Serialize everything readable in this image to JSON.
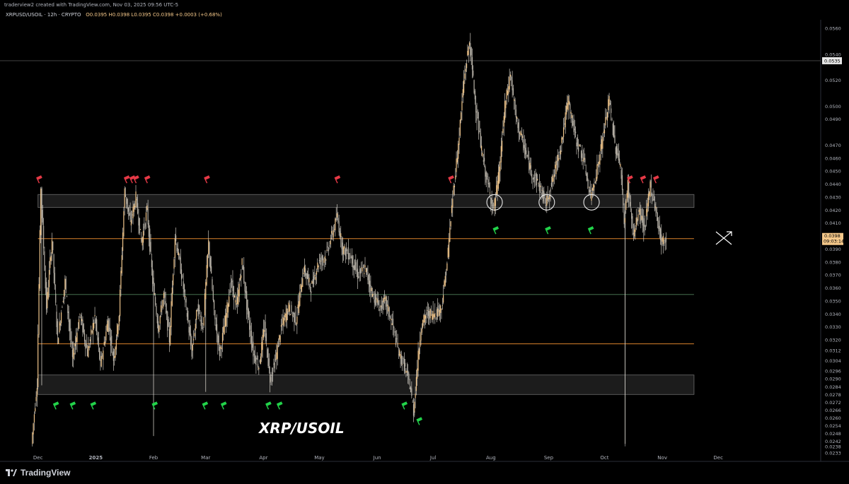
{
  "header": {
    "credit": "traderview2 created with TradingView.com, Nov 03, 2025 09:56 UTC-5",
    "symbol_line": "XRPUSD/USOIL · 12h · CRYPTO",
    "ohlc": "O0.0395  H0.0398  L0.0395  C0.0398  +0.0003 (+0.68%)"
  },
  "watermark": "XRP/USOIL",
  "brand": "TradingView",
  "colors": {
    "candle": "#f0c58a",
    "wick": "#e9e4da",
    "zone_fill": "#1c1c1c",
    "zone_border": "#6b6b6b",
    "orange_line": "#d9822b",
    "green_line": "#4f7f5a",
    "top_flag": "#e53946",
    "bottom_flag": "#22d34a",
    "price_tag": "#f5c88a"
  },
  "chart_data": {
    "type": "candlestick",
    "symbol": "XRPUSD/USOIL",
    "interval": "12h",
    "ylim": [
      0.0233,
      0.056
    ],
    "y_ticks": [
      "0.0560",
      "0.0540",
      "0.0520",
      "0.0500",
      "0.0490",
      "0.0470",
      "0.0460",
      "0.0450",
      "0.0440",
      "0.0430",
      "0.0420",
      "0.0410",
      "0.0400",
      "0.0390",
      "0.0380",
      "0.0370",
      "0.0360",
      "0.0350",
      "0.0340",
      "0.0330",
      "0.0320",
      "0.0312",
      "0.0304",
      "0.0296",
      "0.0290",
      "0.0284",
      "0.0278",
      "0.0272",
      "0.0266",
      "0.0260",
      "0.0254",
      "0.0248",
      "0.0242",
      "0.0238",
      "0.0233"
    ],
    "x_ticks": [
      "Dec",
      "2025",
      "Feb",
      "Mar",
      "Apr",
      "May",
      "Jun",
      "Jul",
      "Aug",
      "Sep",
      "Oct",
      "Nov",
      "Dec"
    ],
    "price_path": [
      [
        "2024-11-28",
        0.024
      ],
      [
        "2024-12-01",
        0.0287
      ],
      [
        "2024-12-03",
        0.0438
      ],
      [
        "2024-12-06",
        0.0345
      ],
      [
        "2024-12-09",
        0.0398
      ],
      [
        "2024-12-12",
        0.032
      ],
      [
        "2024-12-16",
        0.0365
      ],
      [
        "2024-12-20",
        0.0305
      ],
      [
        "2024-12-24",
        0.034
      ],
      [
        "2024-12-28",
        0.031
      ],
      [
        "2025-01-01",
        0.0338
      ],
      [
        "2025-01-04",
        0.03
      ],
      [
        "2025-01-08",
        0.0335
      ],
      [
        "2025-01-11",
        0.0305
      ],
      [
        "2025-01-14",
        0.034
      ],
      [
        "2025-01-17",
        0.0435
      ],
      [
        "2025-01-20",
        0.041
      ],
      [
        "2025-01-23",
        0.043
      ],
      [
        "2025-01-26",
        0.0395
      ],
      [
        "2025-01-29",
        0.042
      ],
      [
        "2025-02-01",
        0.0365
      ],
      [
        "2025-02-04",
        0.033
      ],
      [
        "2025-02-07",
        0.0355
      ],
      [
        "2025-02-10",
        0.032
      ],
      [
        "2025-02-13",
        0.04
      ],
      [
        "2025-02-16",
        0.0375
      ],
      [
        "2025-02-19",
        0.0345
      ],
      [
        "2025-02-22",
        0.031
      ],
      [
        "2025-02-25",
        0.0345
      ],
      [
        "2025-02-28",
        0.033
      ],
      [
        "2025-03-03",
        0.0395
      ],
      [
        "2025-03-06",
        0.034
      ],
      [
        "2025-03-09",
        0.031
      ],
      [
        "2025-03-12",
        0.0335
      ],
      [
        "2025-03-15",
        0.0365
      ],
      [
        "2025-03-18",
        0.0345
      ],
      [
        "2025-03-21",
        0.038
      ],
      [
        "2025-03-24",
        0.034
      ],
      [
        "2025-03-27",
        0.031
      ],
      [
        "2025-03-30",
        0.03
      ],
      [
        "2025-04-02",
        0.033
      ],
      [
        "2025-04-05",
        0.029
      ],
      [
        "2025-04-08",
        0.0305
      ],
      [
        "2025-04-11",
        0.033
      ],
      [
        "2025-04-15",
        0.0345
      ],
      [
        "2025-04-19",
        0.0335
      ],
      [
        "2025-04-23",
        0.0375
      ],
      [
        "2025-04-27",
        0.036
      ],
      [
        "2025-05-01",
        0.038
      ],
      [
        "2025-05-05",
        0.0385
      ],
      [
        "2025-05-08",
        0.04
      ],
      [
        "2025-05-11",
        0.0415
      ],
      [
        "2025-05-14",
        0.039
      ],
      [
        "2025-05-18",
        0.0385
      ],
      [
        "2025-05-22",
        0.037
      ],
      [
        "2025-05-26",
        0.0375
      ],
      [
        "2025-05-30",
        0.0355
      ],
      [
        "2025-06-03",
        0.0345
      ],
      [
        "2025-06-06",
        0.035
      ],
      [
        "2025-06-10",
        0.033
      ],
      [
        "2025-06-13",
        0.031
      ],
      [
        "2025-06-16",
        0.03
      ],
      [
        "2025-06-19",
        0.0285
      ],
      [
        "2025-06-21",
        0.0265
      ],
      [
        "2025-06-23",
        0.03
      ],
      [
        "2025-06-25",
        0.033
      ],
      [
        "2025-06-28",
        0.034
      ],
      [
        "2025-07-02",
        0.034
      ],
      [
        "2025-07-06",
        0.0345
      ],
      [
        "2025-07-09",
        0.038
      ],
      [
        "2025-07-12",
        0.043
      ],
      [
        "2025-07-15",
        0.047
      ],
      [
        "2025-07-18",
        0.052
      ],
      [
        "2025-07-21",
        0.055
      ],
      [
        "2025-07-24",
        0.0505
      ],
      [
        "2025-07-27",
        0.047
      ],
      [
        "2025-07-30",
        0.0445
      ],
      [
        "2025-08-03",
        0.042
      ],
      [
        "2025-08-06",
        0.045
      ],
      [
        "2025-08-09",
        0.05
      ],
      [
        "2025-08-12",
        0.0525
      ],
      [
        "2025-08-15",
        0.049
      ],
      [
        "2025-08-19",
        0.047
      ],
      [
        "2025-08-23",
        0.045
      ],
      [
        "2025-08-27",
        0.044
      ],
      [
        "2025-08-31",
        0.0425
      ],
      [
        "2025-09-04",
        0.0445
      ],
      [
        "2025-09-08",
        0.047
      ],
      [
        "2025-09-12",
        0.0505
      ],
      [
        "2025-09-16",
        0.0475
      ],
      [
        "2025-09-20",
        0.046
      ],
      [
        "2025-09-24",
        0.043
      ],
      [
        "2025-09-28",
        0.0455
      ],
      [
        "2025-10-01",
        0.048
      ],
      [
        "2025-10-04",
        0.0505
      ],
      [
        "2025-10-07",
        0.047
      ],
      [
        "2025-10-10",
        0.0455
      ],
      [
        "2025-10-12",
        0.041
      ],
      [
        "2025-10-14",
        0.044
      ],
      [
        "2025-10-17",
        0.04
      ],
      [
        "2025-10-20",
        0.042
      ],
      [
        "2025-10-23",
        0.0405
      ],
      [
        "2025-10-26",
        0.044
      ],
      [
        "2025-10-29",
        0.042
      ],
      [
        "2025-11-01",
        0.0395
      ],
      [
        "2025-11-03",
        0.0398
      ]
    ],
    "extra_wicks": [
      [
        "2025-02-01",
        0.0246
      ],
      [
        "2025-10-12",
        0.024
      ],
      [
        "2025-03-01",
        0.028
      ],
      [
        "2025-06-21",
        0.0262
      ],
      [
        "2024-12-03",
        0.0285
      ]
    ],
    "zones": [
      {
        "from": 0.0432,
        "to": 0.0422
      },
      {
        "from": 0.0293,
        "to": 0.0278
      }
    ],
    "horizontal_lines": [
      {
        "y": 0.0398,
        "color": "orange"
      },
      {
        "y": 0.0355,
        "color": "green"
      },
      {
        "y": 0.0317,
        "color": "orange"
      },
      {
        "y": 0.0535,
        "color": "gray"
      }
    ],
    "vertical_lines": [
      "2025-10-12"
    ],
    "top_markers": [
      "2024-12-01",
      "2025-01-17",
      "2025-01-20",
      "2025-01-22",
      "2025-01-28",
      "2025-03-01",
      "2025-05-10",
      "2025-07-10",
      "2025-10-14",
      "2025-10-21",
      "2025-10-28"
    ],
    "bottom_markers": [
      "2024-12-10",
      "2024-12-19",
      "2024-12-30",
      "2025-02-01",
      "2025-02-28",
      "2025-03-10",
      "2025-04-03",
      "2025-04-09",
      "2025-06-15",
      "2025-06-23",
      "2025-08-03",
      "2025-08-31",
      "2025-09-23"
    ],
    "circles": [
      "2025-08-03",
      "2025-08-31",
      "2025-09-24"
    ],
    "last_price": {
      "value": "0.0398",
      "countdown": "09:03:14"
    },
    "last_label": "0.0535"
  }
}
